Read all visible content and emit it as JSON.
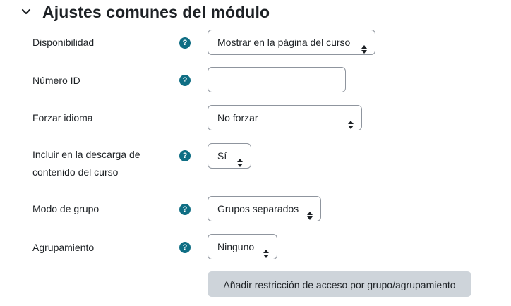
{
  "section": {
    "title": "Ajustes comunes del módulo",
    "expanded": true
  },
  "fields": {
    "availability": {
      "label": "Disponibilidad",
      "value": "Mostrar en la página del curso",
      "has_help": true
    },
    "id_number": {
      "label": "Número ID",
      "value": "",
      "has_help": true
    },
    "force_language": {
      "label": "Forzar idioma",
      "value": "No forzar",
      "has_help": false
    },
    "include_download": {
      "label_line1": "Incluir en la descarga de",
      "label_line2": "contenido del curso",
      "value": "Sí",
      "has_help": true
    },
    "group_mode": {
      "label": "Modo de grupo",
      "value": "Grupos separados",
      "has_help": true
    },
    "grouping": {
      "label": "Agrupamiento",
      "value": "Ninguno",
      "has_help": true
    }
  },
  "buttons": {
    "add_restriction": "Añadir restricción de acceso por grupo/agrupamiento"
  },
  "help_icon_glyph": "?",
  "colors": {
    "help_icon": "#0f6e84",
    "secondary_button": "#ced4da",
    "input_border": "#8f959e",
    "text": "#1d2125"
  }
}
